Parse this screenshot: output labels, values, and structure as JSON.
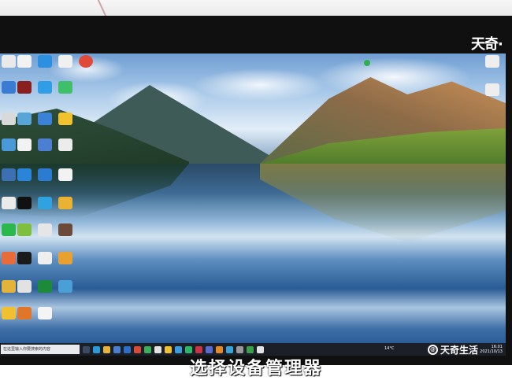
{
  "overlay": {
    "brand_top": "天奇·",
    "brand_bottom": "天奇生活",
    "subtitle": "选择设备管理器"
  },
  "desktop": {
    "wallpaper": "mountain-lake-reflection"
  },
  "taskbar": {
    "search_placeholder": "在这里输入你要搜索的内容",
    "weather": "14°C",
    "clock_time": "16:01",
    "clock_date": "2021/10/13"
  },
  "colors": {
    "frame": "#101010",
    "taskbar": "#1b1f27",
    "sky": "#6f9ed2"
  }
}
